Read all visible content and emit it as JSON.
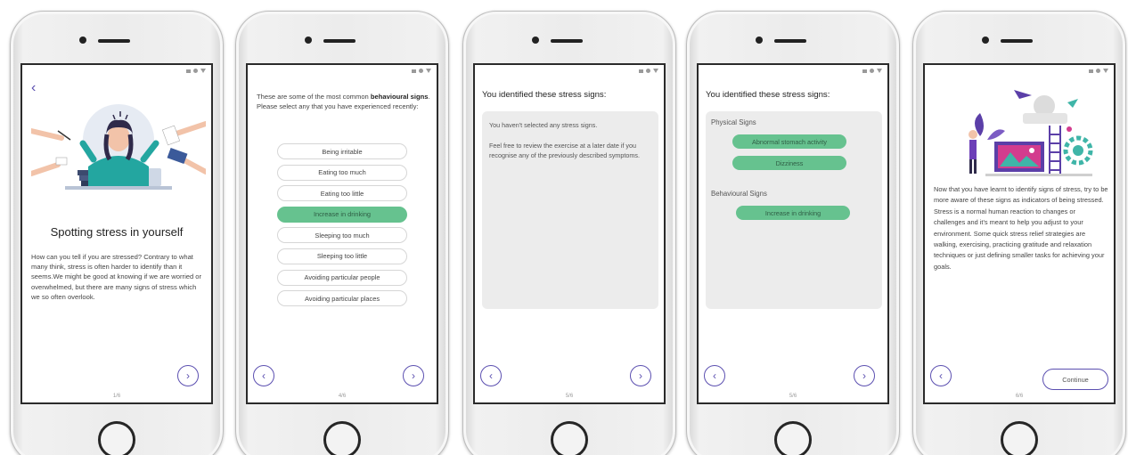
{
  "screens": [
    {
      "title": "Spotting stress in yourself",
      "body": "How can you tell if you are stressed? Contrary to what many think, stress is often harder to identify than it seems.We might be good at knowing if we are worried or overwhelmed, but there are many signs of stress which we so often overlook.",
      "page": "1/6"
    },
    {
      "intro_pre": "These are some of the most common ",
      "intro_bold": "behavioural signs",
      "intro_post": ". Please select any that you have experienced recently:",
      "options": [
        {
          "label": "Being irritable",
          "selected": false
        },
        {
          "label": "Eating too much",
          "selected": false
        },
        {
          "label": "Eating too little",
          "selected": false
        },
        {
          "label": "Increase in drinking",
          "selected": true
        },
        {
          "label": "Sleeping too much",
          "selected": false
        },
        {
          "label": "Sleeping too little",
          "selected": false
        },
        {
          "label": "Avoiding particular people",
          "selected": false
        },
        {
          "label": "Avoiding particular places",
          "selected": false
        }
      ],
      "page": "4/6"
    },
    {
      "heading": "You identified these stress signs:",
      "para1": "You haven't selected any stress signs.",
      "para2": "Feel free to review the exercise at a later date if you recognise any of the previously described symptoms.",
      "page": "5/6"
    },
    {
      "heading": "You identified these stress signs:",
      "physical_label": "Physical Signs",
      "physical_tags": [
        "Abnormal stomach activity",
        "Dizziness"
      ],
      "behavioural_label": "Behavioural Signs",
      "behavioural_tags": [
        "Increase in drinking"
      ],
      "page": "5/6"
    },
    {
      "body1": "Now that you have learnt to identify signs of stress, try to be more aware of these signs as indicators of being stressed.",
      "body2": "Stress is a normal human reaction to changes or challenges and it's meant to help you adjust to your environment. Some quick stress relief strategies are walking, exercising, practicing gratitude and relaxation techniques or just defining smaller tasks for achieving your goals.",
      "continue_label": "Continue",
      "page": "6/6"
    }
  ],
  "icons": {
    "back": "‹",
    "prev": "‹",
    "next": "›"
  },
  "colors": {
    "accent": "#5b4fb0",
    "selected": "#66c28f",
    "panel": "#ececec"
  }
}
